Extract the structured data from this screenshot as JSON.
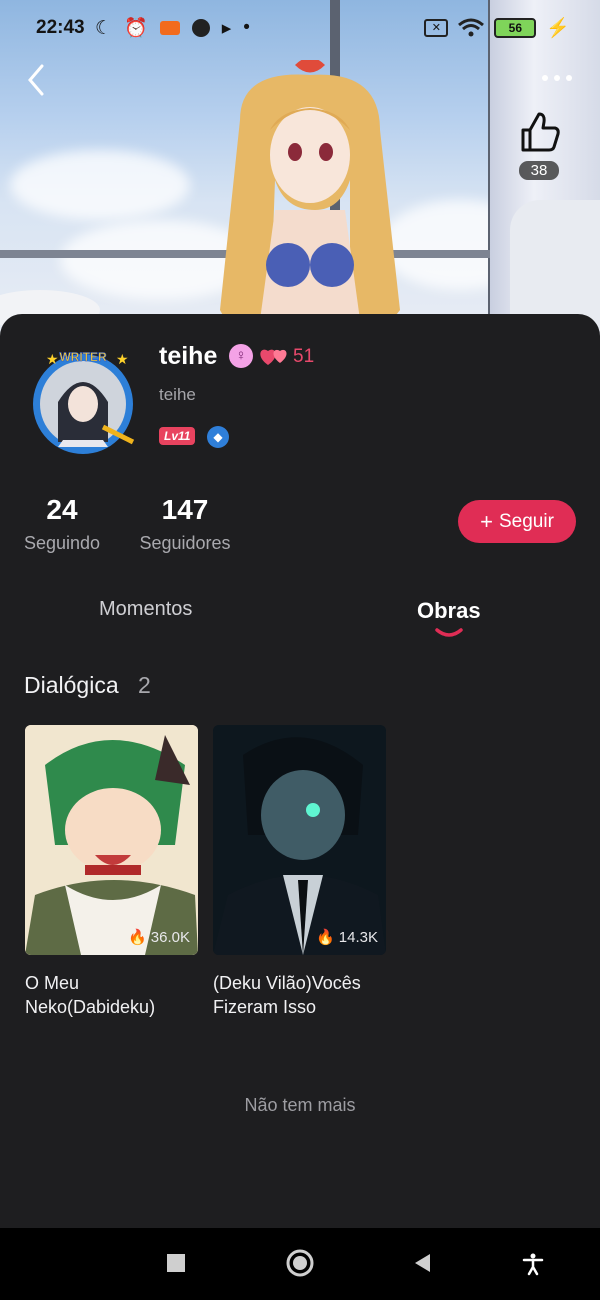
{
  "status_bar": {
    "time": "22:43",
    "battery": "56",
    "left_icons": [
      "moon-icon",
      "alarm-icon",
      "video-icon",
      "no-sign-icon",
      "play-icon",
      "dot-icon"
    ],
    "right_icons": [
      "sim-off-icon",
      "wifi-icon",
      "battery-icon",
      "charging-icon"
    ]
  },
  "header": {
    "like_count": "38"
  },
  "profile": {
    "display_name": "teihe",
    "username": "teihe",
    "hearts": "51",
    "level": "Lv11",
    "avatar_badge": "WRITER",
    "gender_symbol": "♀"
  },
  "stats": {
    "following_count": "24",
    "following_label": "Seguindo",
    "followers_count": "147",
    "followers_label": "Seguidores"
  },
  "follow_button": {
    "label": "Seguir",
    "icon": "+"
  },
  "tabs": [
    {
      "label": "Momentos",
      "active": false
    },
    {
      "label": "Obras",
      "active": true
    }
  ],
  "section": {
    "title": "Dialógica",
    "count": "2"
  },
  "works": [
    {
      "title": "O Meu Neko(Dabideku)",
      "views": "36.0K"
    },
    {
      "title": "(Deku Vilão)Vocês Fizeram Isso",
      "views": "14.3K"
    }
  ],
  "end_text": "Não tem mais",
  "colors": {
    "accent": "#e02d55",
    "background": "#1e1e20",
    "hearts": "#e8496c",
    "level_badge": "#e8435f"
  }
}
